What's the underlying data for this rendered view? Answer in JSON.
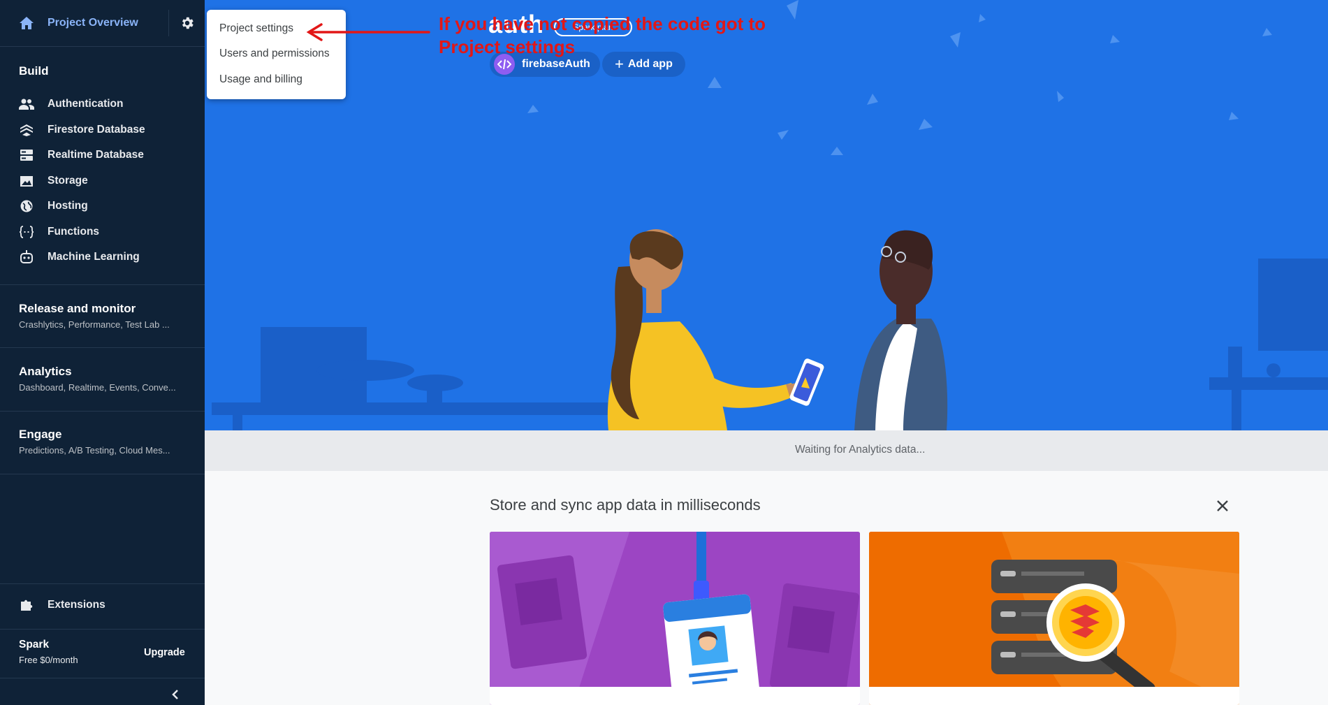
{
  "sidebar": {
    "project_overview": "Project Overview",
    "build_heading": "Build",
    "build_items": [
      {
        "label": "Authentication",
        "icon": "people-icon"
      },
      {
        "label": "Firestore Database",
        "icon": "firestore-icon"
      },
      {
        "label": "Realtime Database",
        "icon": "database-icon"
      },
      {
        "label": "Storage",
        "icon": "image-icon"
      },
      {
        "label": "Hosting",
        "icon": "globe-icon"
      },
      {
        "label": "Functions",
        "icon": "functions-icon"
      },
      {
        "label": "Machine Learning",
        "icon": "robot-icon"
      }
    ],
    "sections": [
      {
        "title": "Release and monitor",
        "subtitle": "Crashlytics, Performance, Test Lab ..."
      },
      {
        "title": "Analytics",
        "subtitle": "Dashboard, Realtime, Events, Conve..."
      },
      {
        "title": "Engage",
        "subtitle": "Predictions, A/B Testing, Cloud Mes..."
      }
    ],
    "extensions": "Extensions",
    "plan_name": "Spark",
    "plan_price": "Free $0/month",
    "upgrade": "Upgrade"
  },
  "settings_menu": {
    "items": [
      "Project settings",
      "Users and permissions",
      "Usage and billing"
    ]
  },
  "header": {
    "project_title_partial": "auth",
    "plan_chip": "Spark plan",
    "app_chip": "firebaseAuth",
    "add_app": "Add app"
  },
  "annotation": {
    "line1": "If you have not copied the code got  to",
    "line2": "Project settings"
  },
  "analytics_status": "Waiting for Analytics data...",
  "promo": {
    "title": "Store and sync app data in milliseconds"
  },
  "colors": {
    "sidebar_bg": "#0f2237",
    "hero_bg": "#1f72e6",
    "annotation_red": "#e21717",
    "accent_blue": "#8ab4f8"
  }
}
